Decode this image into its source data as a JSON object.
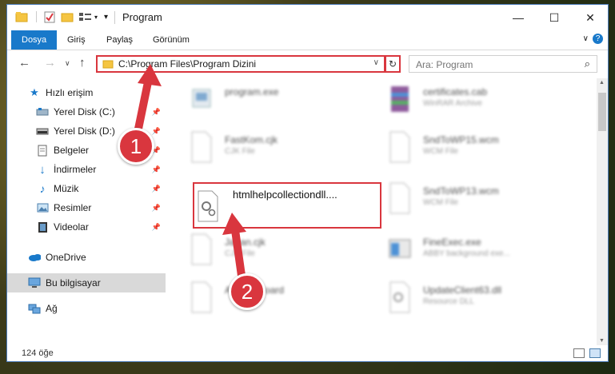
{
  "window": {
    "title": "Program",
    "minimize": "—",
    "maximize": "☐",
    "close": "✕"
  },
  "ribbon": {
    "tabs": [
      "Dosya",
      "Giriş",
      "Paylaş",
      "Görünüm"
    ],
    "help": "?"
  },
  "nav": {
    "back": "←",
    "forward": "→",
    "recent": "∨",
    "up": "↑",
    "address": "C:\\Program Files\\Program Dizini",
    "address_dropdown": "∨",
    "refresh": "↻",
    "search_placeholder": "Ara: Program",
    "search_icon": "⌕"
  },
  "sidebar": {
    "items": [
      {
        "label": "Hızlı erişim",
        "icon": "star-icon",
        "pinned": false
      },
      {
        "label": "Yerel Disk (C:)",
        "icon": "disk-icon",
        "pinned": true
      },
      {
        "label": "Yerel Disk (D:)",
        "icon": "disk-icon",
        "pinned": true
      },
      {
        "label": "Belgeler",
        "icon": "document-icon",
        "pinned": true
      },
      {
        "label": "İndirmeler",
        "icon": "download-icon",
        "pinned": true
      },
      {
        "label": "Müzik",
        "icon": "music-icon",
        "pinned": true
      },
      {
        "label": "Resimler",
        "icon": "pictures-icon",
        "pinned": true
      },
      {
        "label": "Videolar",
        "icon": "video-icon",
        "pinned": true
      },
      {
        "label": "OneDrive",
        "icon": "cloud-icon",
        "pinned": false
      },
      {
        "label": "Bu bilgisayar",
        "icon": "computer-icon",
        "pinned": false
      },
      {
        "label": "Ağ",
        "icon": "network-icon",
        "pinned": false
      }
    ],
    "pin_glyph": "📌"
  },
  "files": {
    "left": [
      {
        "name": "program.exe",
        "desc": ""
      },
      {
        "name": "FastKom.cjk",
        "desc": "CJK File"
      },
      {
        "name": "htmlhelpcollectiondll....",
        "desc": ""
      },
      {
        "name": "Japan.cjk",
        "desc": "CJK File"
      },
      {
        "name": "AirStatsBoard",
        "desc": ""
      }
    ],
    "right": [
      {
        "name": "certificates.cab",
        "desc": "WinRAR Archive"
      },
      {
        "name": "SndToWP15.wcm",
        "desc": "WCM File"
      },
      {
        "name": "SndToWP13.wcm",
        "desc": "WCM File"
      },
      {
        "name": "FineExec.exe",
        "desc": "ABBY background exe..."
      },
      {
        "name": "UpdateClient63.dll",
        "desc": "Resource DLL"
      }
    ]
  },
  "status": {
    "count": "124 öğe"
  },
  "annotations": {
    "marker1": "1",
    "marker2": "2"
  },
  "colors": {
    "accent": "#1979ca",
    "highlight": "#d9363e"
  }
}
